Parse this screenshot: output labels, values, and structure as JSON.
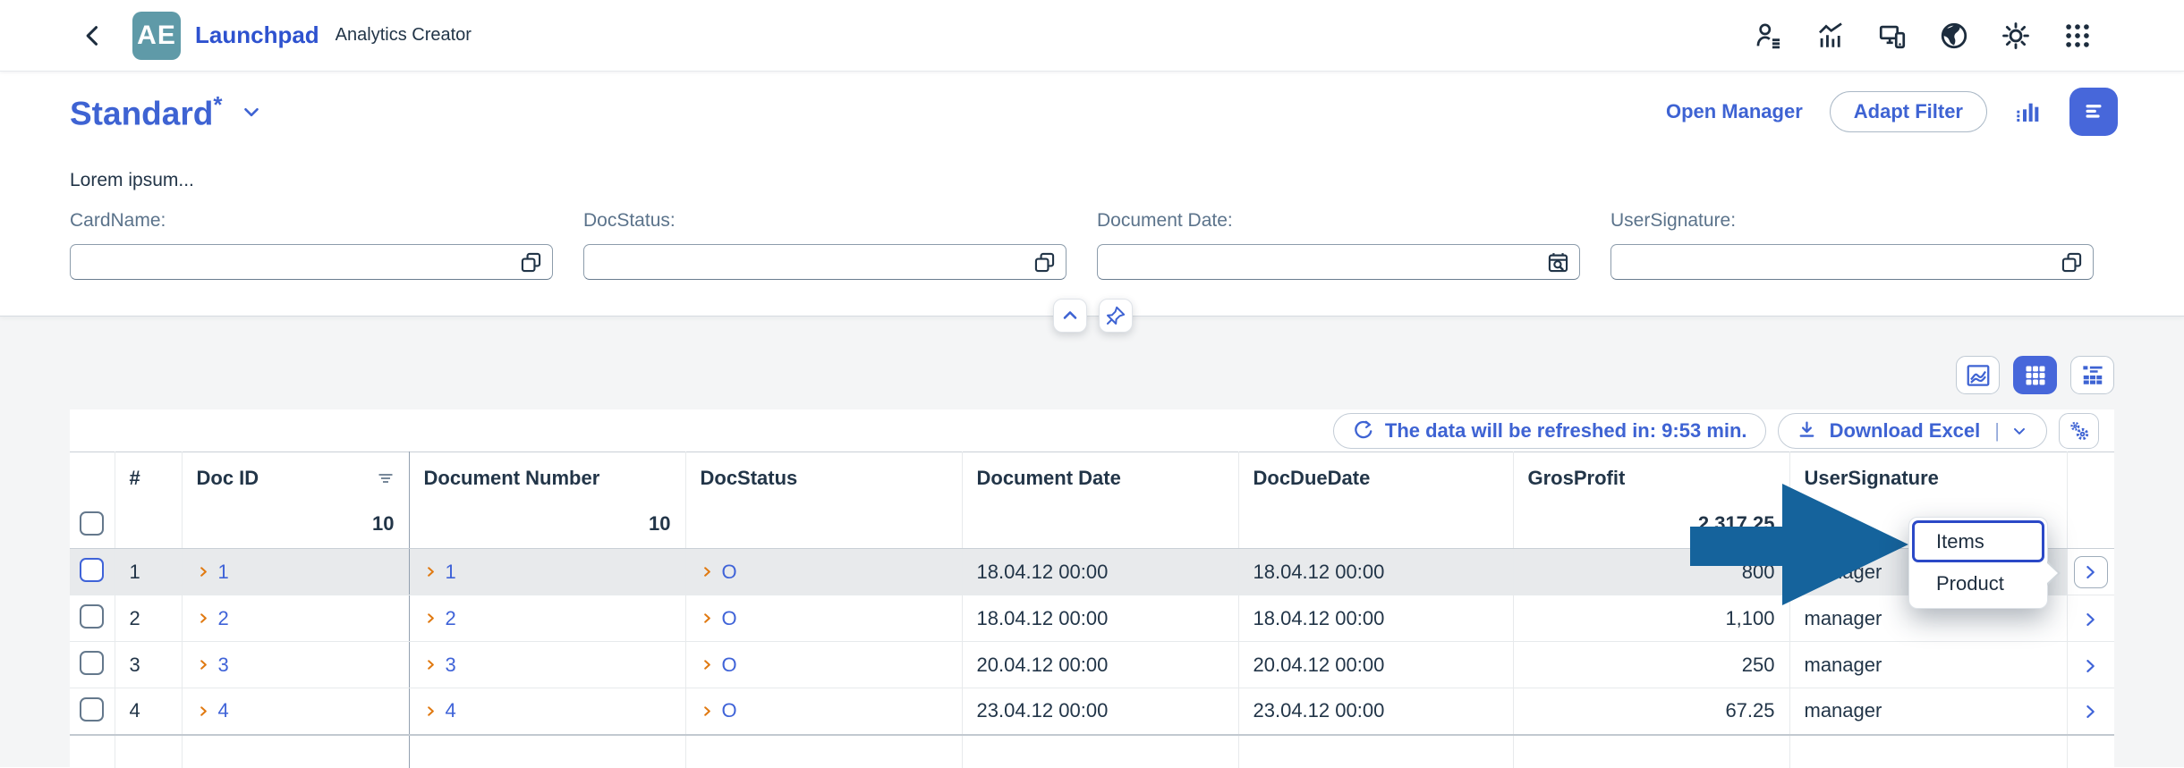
{
  "shell": {
    "logo_text": "AE",
    "title": "Launchpad",
    "subtitle": "Analytics Creator"
  },
  "page": {
    "variant_title": "Standard",
    "variant_modified_marker": "*",
    "description": "Lorem ipsum...",
    "open_manager_label": "Open Manager",
    "adapt_filter_label": "Adapt Filter"
  },
  "filters": [
    {
      "label": "CardName:",
      "value": "",
      "icon": "value-help"
    },
    {
      "label": "DocStatus:",
      "value": "",
      "icon": "value-help"
    },
    {
      "label": "Document Date:",
      "value": "",
      "icon": "date-picker"
    },
    {
      "label": "UserSignature:",
      "value": "",
      "icon": "value-help"
    }
  ],
  "toolbar": {
    "refresh_note": "The data will be refreshed in: 9:53 min.",
    "download_label": "Download Excel",
    "download_separator": "|"
  },
  "table": {
    "columns": [
      "#",
      "Doc ID",
      "Document Number",
      "DocStatus",
      "Document Date",
      "DocDueDate",
      "GrosProfit",
      "UserSignature"
    ],
    "totals": {
      "doc_id_count": "10",
      "document_number_count": "10",
      "gros_profit_total": "2,317.25"
    },
    "rows": [
      {
        "num": "1",
        "doc_id": "1",
        "document_number": "1",
        "doc_status": "O",
        "document_date": "18.04.12 00:00",
        "doc_due_date": "18.04.12 00:00",
        "gros_profit": "800",
        "user_signature": "manager"
      },
      {
        "num": "2",
        "doc_id": "2",
        "document_number": "2",
        "doc_status": "O",
        "document_date": "18.04.12 00:00",
        "doc_due_date": "18.04.12 00:00",
        "gros_profit": "1,100",
        "user_signature": "manager"
      },
      {
        "num": "3",
        "doc_id": "3",
        "document_number": "3",
        "doc_status": "O",
        "document_date": "20.04.12 00:00",
        "doc_due_date": "20.04.12 00:00",
        "gros_profit": "250",
        "user_signature": "manager"
      },
      {
        "num": "4",
        "doc_id": "4",
        "document_number": "4",
        "doc_status": "O",
        "document_date": "23.04.12 00:00",
        "doc_due_date": "23.04.12 00:00",
        "gros_profit": "67.25",
        "user_signature": "manager"
      }
    ]
  },
  "context_menu": {
    "items": [
      "Items",
      "Product"
    ],
    "focused_item": "Items"
  },
  "colors": {
    "accent_blue": "#3e63d3",
    "annotation_arrow_blue": "#15639c",
    "link_blue": "#3f63d8",
    "cell_chevron_orange": "#e07a12",
    "logo_teal": "#5f9aa8",
    "text_dark": "#223548",
    "content_background": "#f4f5f6"
  }
}
